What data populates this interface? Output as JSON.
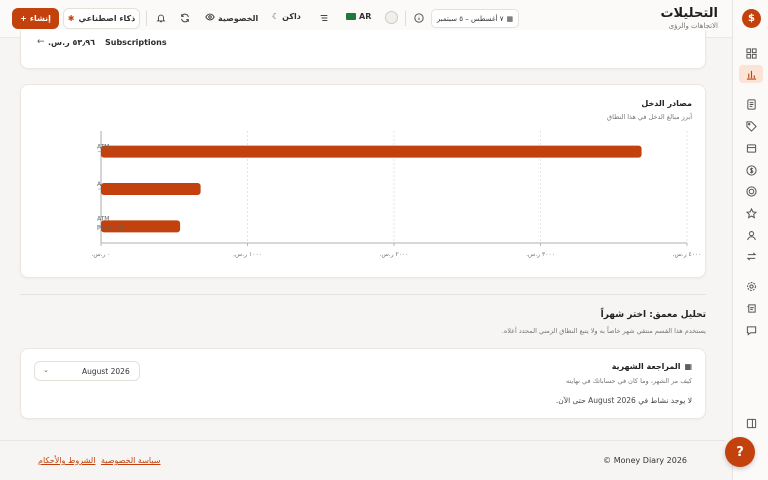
{
  "header": {
    "title": "التحليلات",
    "subtitle": "الاتجاهات والرؤى",
    "date_range": "٧ أغسطس – ٥ سبتمبر",
    "language": "AR",
    "theme_label": "داكن",
    "privacy_label": "الخصوصية",
    "ai_label": "ذكاء اصطناعي",
    "create_label": "إنشاء"
  },
  "subscriptions": {
    "name": "Subscriptions",
    "amount": "٥٣٫٩٦ ر.س."
  },
  "income_card": {
    "title": "مصادر الدخل",
    "subtitle": "أبرز مبالغ الدخل في هذا النطاق"
  },
  "chart_data": {
    "type": "bar",
    "orientation": "horizontal",
    "categories": [
      "ATM ...",
      "A...",
      "ATM petty cash"
    ],
    "values": [
      3690,
      680,
      540
    ],
    "xlim": [
      0,
      4000
    ],
    "x_ticks": [
      "٠ ر.س.",
      "١٠٠٠ ر.س.",
      "٢٠٠٠ ر.س.",
      "٣٠٠٠ ر.س.",
      "٤٠٠٠ ر.س."
    ],
    "grid": true,
    "bar_color": "#c2410c"
  },
  "deep_dive": {
    "title": "تحليل معمق: اختر شهراً",
    "subtitle": "يستخدم هذا القسم منتقي شهر خاصاً به ولا يتبع النطاق الزمني المحدد أعلاه."
  },
  "monthly_review": {
    "title": "المراجعة الشهرية",
    "subtitle": "كيف مر الشهر، وما كان في حساباتك في نهايته",
    "empty_text": "لا يوجد نشاط في August 2026 حتى الآن.",
    "selected_month": "August 2026"
  },
  "footer": {
    "copyright": "© Money Diary 2026",
    "privacy_link": "سياسة الخصوصية",
    "terms_link": "الشروط والأحكام"
  },
  "sidebar": {
    "items": [
      "dashboard-icon",
      "analytics-icon",
      "report-icon",
      "tag-icon",
      "box-icon",
      "dollar-icon",
      "target-icon",
      "star-icon",
      "user-icon",
      "transfer-icon",
      "settings-icon",
      "scroll-icon",
      "message-icon",
      "panel-icon"
    ]
  },
  "colors": {
    "accent": "#c2410c",
    "accent_light": "#fbe3d6"
  }
}
